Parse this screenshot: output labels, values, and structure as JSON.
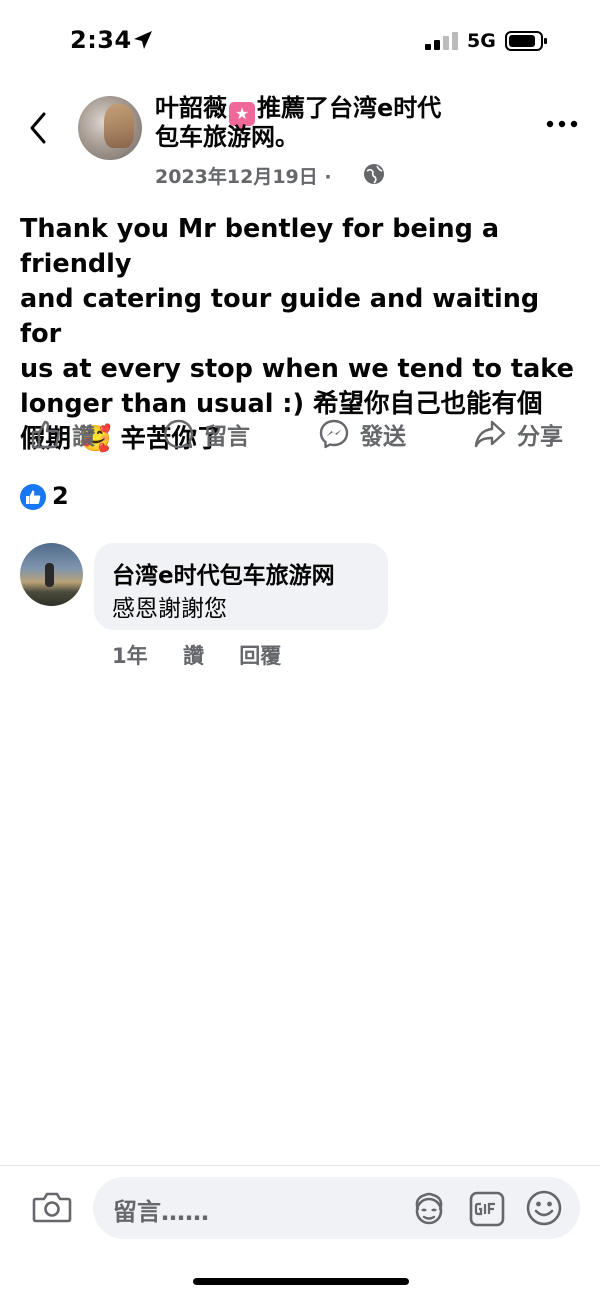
{
  "status_bar": {
    "time": "2:34",
    "network": "5G"
  },
  "header": {
    "author": "叶韶薇",
    "action_text_line1": "推薦了台湾e时代",
    "action_text_line2": "包车旅游网。",
    "date": "2023年12月19日 ·"
  },
  "post": {
    "text_lines": [
      "Thank you Mr bentley for being a friendly",
      "and catering tour guide and waiting for",
      "us at every stop when we tend to take",
      "longer than usual :) 希望你自己也能有個",
      "假期 🥰 辛苦你了"
    ]
  },
  "actions": {
    "like": "讚",
    "comment": "留言",
    "send": "發送",
    "share": "分享"
  },
  "reactions": {
    "count": "2"
  },
  "comment": {
    "author": "台湾e时代包车旅游网",
    "text": "感恩謝謝您",
    "time": "1年",
    "like": "讚",
    "reply": "回覆"
  },
  "composer": {
    "placeholder": "留言……"
  },
  "colors": {
    "secondary_text": "#65676b",
    "bubble": "#f0f2f5",
    "like_blue": "#1877f2"
  }
}
